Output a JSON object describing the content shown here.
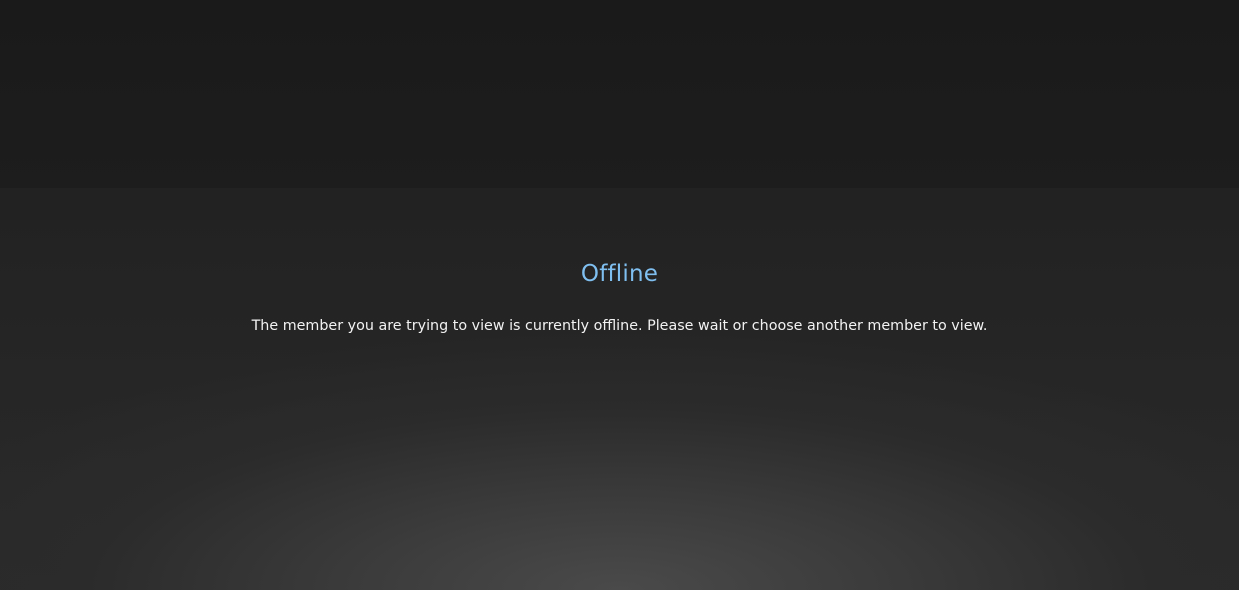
{
  "offline": {
    "title": "Offline",
    "message": "The member you are trying to view is currently offline. Please wait or choose another member to view."
  },
  "colors": {
    "title": "#7fbff0",
    "message": "#f2f2f2",
    "background_top": "#1a1a1a",
    "background_bottom_glow": "#4a4a4a"
  }
}
